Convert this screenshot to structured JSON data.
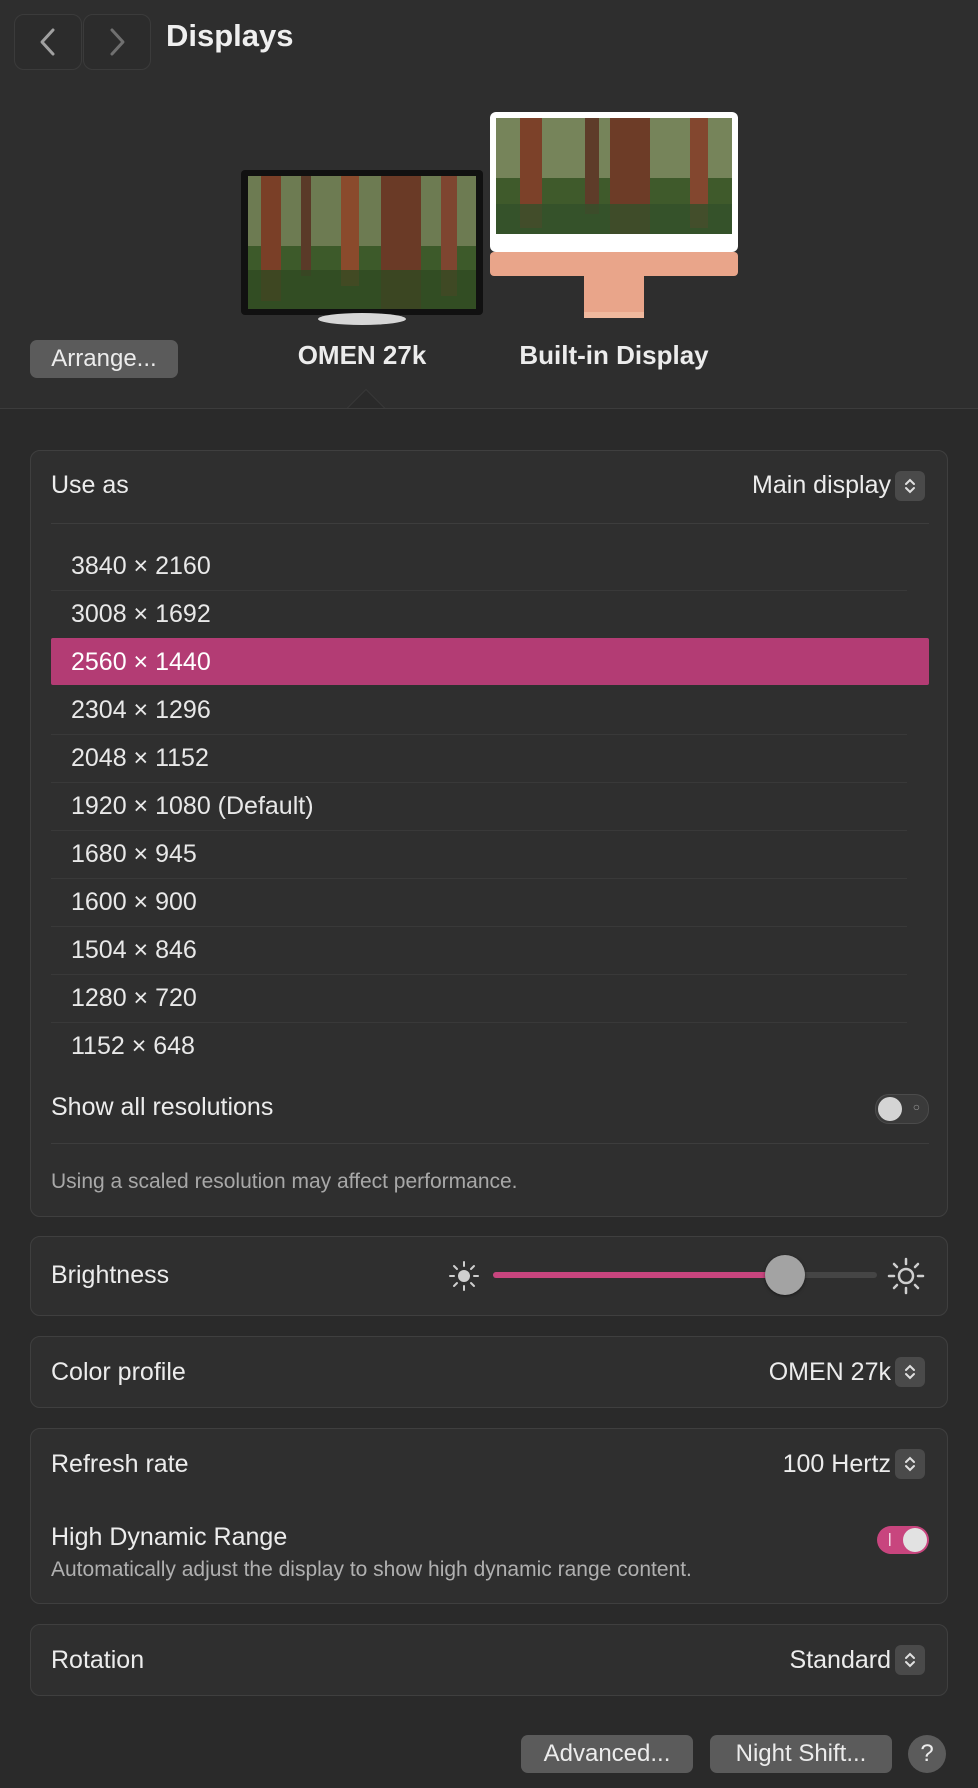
{
  "window": {
    "title": "Displays",
    "back_icon": "chevron-left-icon",
    "forward_icon": "chevron-right-icon"
  },
  "header": {
    "arrange_label": "Arrange...",
    "displays": [
      {
        "name": "OMEN 27k",
        "selected": true
      },
      {
        "name": "Built-in Display",
        "selected": false
      }
    ]
  },
  "use_as": {
    "label": "Use as",
    "value": "Main display"
  },
  "resolutions": {
    "items": [
      "3840 × 2160",
      "3008 × 1692",
      "2560 × 1440",
      "2304 × 1296",
      "2048 × 1152",
      "1920 × 1080 (Default)",
      "1680 × 945",
      "1600 × 900",
      "1504 × 846",
      "1280 × 720",
      "1152 × 648"
    ],
    "selected": "2560 × 1440",
    "selection_color": "#b33c74"
  },
  "show_all_resolutions": {
    "label": "Show all resolutions",
    "on": false
  },
  "scaled_note": "Using a scaled resolution may affect performance.",
  "brightness": {
    "label": "Brightness",
    "level": 0.76,
    "accent": "#c8457e",
    "low_icon": "sun-small-icon",
    "high_icon": "sun-large-icon"
  },
  "color_profile": {
    "label": "Color profile",
    "value": "OMEN 27k"
  },
  "refresh_rate": {
    "label": "Refresh rate",
    "value": "100 Hertz"
  },
  "hdr": {
    "label": "High Dynamic Range",
    "description": "Automatically adjust the display to show high dynamic range content.",
    "on": true
  },
  "rotation": {
    "label": "Rotation",
    "value": "Standard"
  },
  "footer": {
    "advanced_label": "Advanced...",
    "night_shift_label": "Night Shift...",
    "help_label": "?"
  }
}
